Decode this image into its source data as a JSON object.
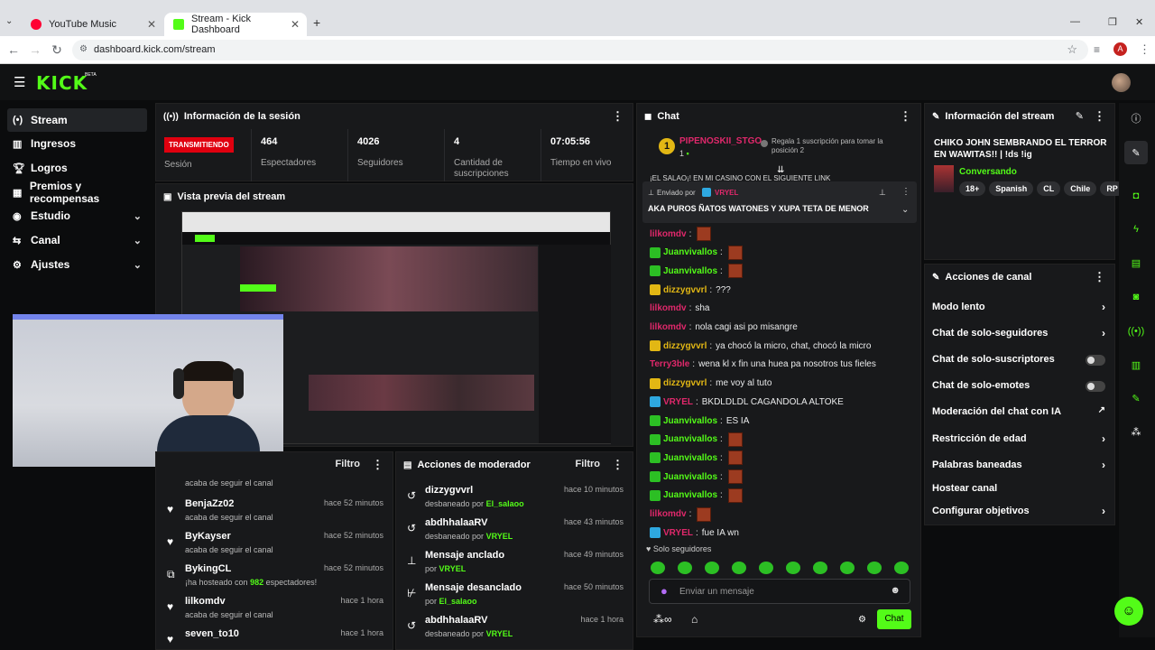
{
  "browser": {
    "tabs": [
      {
        "title": "YouTube Music",
        "color": "#ff0033"
      },
      {
        "title": "Stream - Kick Dashboard",
        "color": "#53fc18"
      }
    ],
    "new_tab": "+",
    "url": "dashboard.kick.com/stream",
    "profile_initial": "A"
  },
  "kick": {
    "logo": "KICK",
    "beta": "BETA",
    "sidebar": [
      {
        "label": "Stream",
        "icon": "live-icon",
        "active": true
      },
      {
        "label": "Ingresos",
        "icon": "revenue-icon"
      },
      {
        "label": "Logros",
        "icon": "trophy-icon"
      },
      {
        "label": "Premios y recompensas",
        "icon": "gift-icon"
      },
      {
        "label": "Estudio",
        "icon": "studio-icon",
        "chevron": "⌄"
      },
      {
        "label": "Canal",
        "icon": "channel-icon",
        "chevron": "⌄"
      },
      {
        "label": "Ajustes",
        "icon": "gear-icon",
        "chevron": "⌄"
      }
    ],
    "session": {
      "title": "Información de la sesión",
      "status_badge": "TRANSMITIENDO",
      "status_label": "Sesión",
      "stats": [
        {
          "value": "464",
          "label": "Espectadores"
        },
        {
          "value": "4026",
          "label": "Seguidores"
        },
        {
          "value": "4",
          "label": "Cantidad de suscripciones"
        },
        {
          "value": "07:05:56",
          "label": "Tiempo en vivo"
        }
      ]
    },
    "preview": {
      "title": "Vista previa del stream"
    },
    "activity": {
      "filter": "Filtro",
      "items": [
        {
          "name": "",
          "desc": "acaba de seguir el canal",
          "time": "",
          "icon": "heart-icon"
        },
        {
          "name": "BenjaZz02",
          "desc": "acaba de seguir el canal",
          "time": "hace 52 minutos",
          "icon": "heart-icon"
        },
        {
          "name": "ByKayser",
          "desc": "acaba de seguir el canal",
          "time": "hace 52 minutos",
          "icon": "heart-icon"
        },
        {
          "name": "BykingCL",
          "desc_pre": "¡ha hosteado con",
          "desc_num": "982",
          "desc_post": "espectadores!",
          "time": "hace 52 minutos",
          "icon": "host-icon"
        },
        {
          "name": "lilkomdv",
          "desc": "acaba de seguir el canal",
          "time": "hace 1 hora",
          "icon": "heart-icon"
        },
        {
          "name": "seven_to10",
          "desc": "",
          "time": "hace 1 hora",
          "icon": "heart-icon"
        }
      ]
    },
    "mod": {
      "title": "Acciones de moderador",
      "filter": "Filtro",
      "items": [
        {
          "name": "dizzygvvrl",
          "pre": "desbaneado por",
          "by": "El_salaoo",
          "time": "hace 10 minutos",
          "icon": "unban-icon"
        },
        {
          "name": "abdhhalaaRV",
          "pre": "desbaneado por",
          "by": "VRYEL",
          "time": "hace 43 minutos",
          "icon": "unban-icon"
        },
        {
          "name": "Mensaje anclado",
          "pre": "por",
          "by": "VRYEL",
          "time": "hace 49 minutos",
          "icon": "pin-icon"
        },
        {
          "name": "Mensaje desanclado",
          "pre": "por",
          "by": "El_salaoo",
          "time": "hace 50 minutos",
          "icon": "unpin-icon"
        },
        {
          "name": "abdhhalaaRV",
          "pre": "desbaneado por",
          "by": "VRYEL",
          "time": "hace 1 hora",
          "icon": "unban-icon"
        }
      ]
    },
    "chat": {
      "title": "Chat",
      "top_gifter": {
        "rank": "1",
        "name": "PIPENOSKII_STGO",
        "count": "1",
        "notice": "Regala 1 suscripción para tomar la posición 2"
      },
      "pinned": {
        "label": "Enviado por",
        "by": "VRYEL",
        "text": "AKA PUROS ÑATOS WATONES Y XUPA TETA DE MENOR"
      },
      "cut_line": "¡EL SALAO¡! EN MI CASINO CON EL SIGUIENTE LINK",
      "messages": [
        {
          "user": "lilkomdv",
          "color": "#e0286b",
          "badge": "",
          "text": "",
          "emotes": 1
        },
        {
          "user": "Juanvivallos",
          "color": "#53fc18",
          "badge": "#2cbf24",
          "text": "",
          "emotes": 1
        },
        {
          "user": "Juanvivallos",
          "color": "#53fc18",
          "badge": "#2cbf24",
          "text": "",
          "emotes": 1
        },
        {
          "user": "dizzygvvrl",
          "color": "#e2b714",
          "badge": "#e2b714",
          "text": "???",
          "emotes": 0
        },
        {
          "user": "lilkomdv",
          "color": "#e0286b",
          "badge": "",
          "text": "sha",
          "emotes": 0
        },
        {
          "user": "lilkomdv",
          "color": "#e0286b",
          "badge": "",
          "text": "nola cagi asi po misangre",
          "emotes": 0
        },
        {
          "user": "dizzygvvrl",
          "color": "#e2b714",
          "badge": "#e2b714",
          "text": "ya chocó la micro, chat, chocó la micro",
          "emotes": 0
        },
        {
          "user": "Terry3ble",
          "color": "#e0286b",
          "badge": "",
          "text": "wena kl x fin una huea pa nosotros tus fieles",
          "emotes": 0
        },
        {
          "user": "dizzygvvrl",
          "color": "#e2b714",
          "badge": "#e2b714",
          "text": "me voy al tuto",
          "emotes": 0
        },
        {
          "user": "VRYEL",
          "color": "#e0286b",
          "badge": "#2ea8e0",
          "text": "BKDLDLDL CAGANDOLA ALTOKE",
          "emotes": 0
        },
        {
          "user": "Juanvivallos",
          "color": "#53fc18",
          "badge": "#2cbf24",
          "text": "ES IA",
          "emotes": 0
        },
        {
          "user": "Juanvivallos",
          "color": "#53fc18",
          "badge": "#2cbf24",
          "text": "",
          "emotes": 1
        },
        {
          "user": "Juanvivallos",
          "color": "#53fc18",
          "badge": "#2cbf24",
          "text": "",
          "emotes": 1
        },
        {
          "user": "Juanvivallos",
          "color": "#53fc18",
          "badge": "#2cbf24",
          "text": "",
          "emotes": 1
        },
        {
          "user": "Juanvivallos",
          "color": "#53fc18",
          "badge": "#2cbf24",
          "text": "",
          "emotes": 1
        },
        {
          "user": "lilkomdv",
          "color": "#e0286b",
          "badge": "",
          "text": "",
          "emotes": 1
        },
        {
          "user": "VRYEL",
          "color": "#e0286b",
          "badge": "#2ea8e0",
          "text": "fue IA wn",
          "emotes": 0
        }
      ],
      "followers_only": "Solo seguidores",
      "input_placeholder": "Enviar un mensaje",
      "send": "Chat"
    },
    "stream_info": {
      "title": "Información del stream",
      "stream_title": "CHIKO JOHN SEMBRANDO EL TERROR EN WAWITAS!! | !ds !ig",
      "category": "Conversando",
      "tags": [
        "18+",
        "Spanish",
        "CL",
        "Chile",
        "RP"
      ]
    },
    "channel_actions": {
      "title": "Acciones de canal",
      "items": [
        {
          "label": "Modo lento",
          "ctrl": "chevron"
        },
        {
          "label": "Chat de solo-seguidores",
          "ctrl": "chevron"
        },
        {
          "label": "Chat de solo-suscriptores",
          "ctrl": "toggle",
          "on": false
        },
        {
          "label": "Chat de solo-emotes",
          "ctrl": "toggle",
          "on": false
        },
        {
          "label": "Moderación del chat con IA",
          "ctrl": "external"
        },
        {
          "label": "Restricción de edad",
          "ctrl": "chevron"
        },
        {
          "label": "Palabras baneadas",
          "ctrl": "chevron"
        },
        {
          "label": "Hostear canal",
          "ctrl": "none"
        },
        {
          "label": "Configurar objetivos",
          "ctrl": "chevron"
        }
      ]
    },
    "right_rail": [
      "info-icon",
      "edit-icon",
      "camera-icon",
      "bolt-icon",
      "notes-icon",
      "chat-icon",
      "broadcast-icon",
      "layout-icon",
      "wrench-icon",
      "more-icon"
    ],
    "accent": "#53fc18"
  }
}
